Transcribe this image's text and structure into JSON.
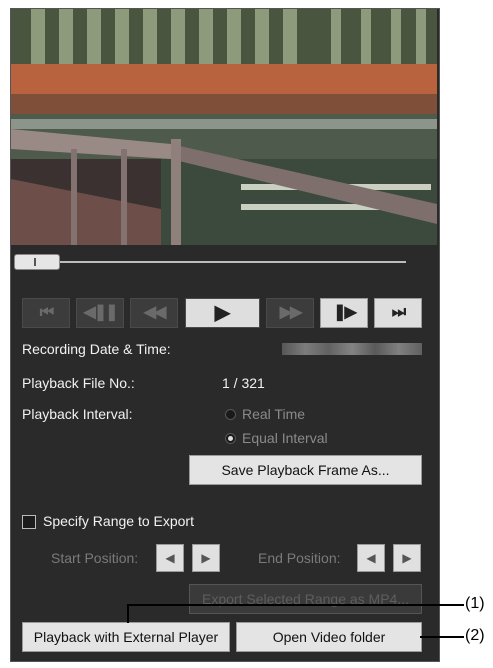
{
  "video": {
    "description_icon": "camera-frame"
  },
  "controls": {
    "first": "⏮",
    "prev_frame": "◀❚❚",
    "rewind": "◀◀",
    "play": "▶",
    "fast_forward": "▶▶",
    "next_frame": "❚▶",
    "last": "⏭"
  },
  "info": {
    "recording_label": "Recording Date & Time:",
    "file_no_label": "Playback File No.:",
    "file_no_value": "1 / 321",
    "interval_label": "Playback Interval:",
    "interval_options": [
      "Real Time",
      "Equal Interval"
    ],
    "interval_selected": "Equal Interval"
  },
  "buttons": {
    "save_frame": "Save Playback Frame As...",
    "export_mp4": "Export Selected Range as MP4...",
    "external_player": "Playback with External Player",
    "open_folder": "Open Video folder"
  },
  "export": {
    "specify_range": "Specify Range to Export",
    "start_label": "Start Position:",
    "end_label": "End Position:"
  },
  "callouts": {
    "one": "(1)",
    "two": "(2)"
  },
  "colors": {
    "panel": "#2a2a2a",
    "button": "#e4e4e4",
    "disabled_text": "#5e5e5e"
  }
}
